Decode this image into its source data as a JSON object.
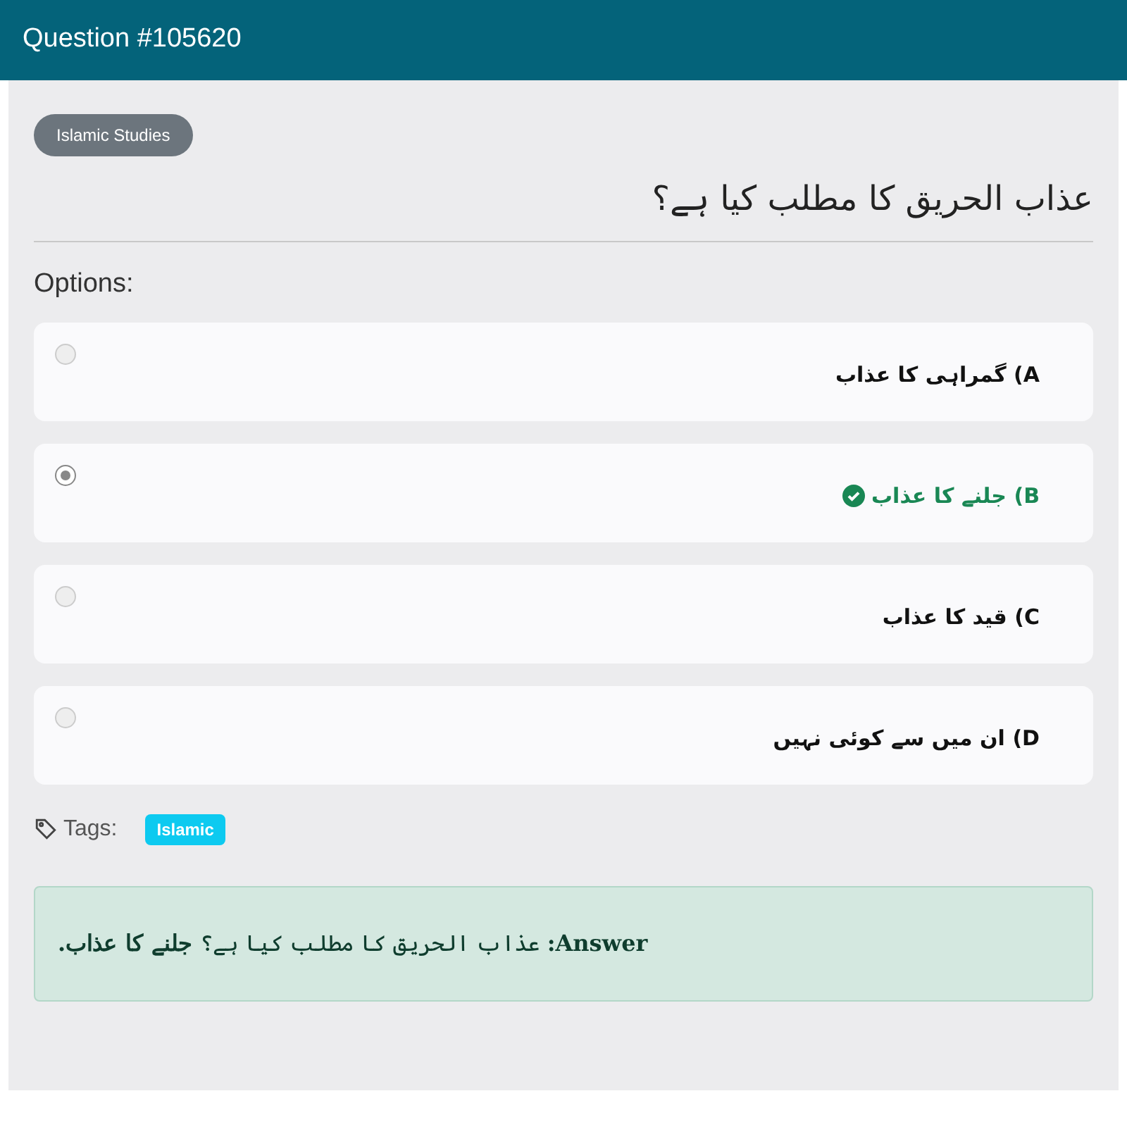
{
  "header": {
    "title": "Question #105620"
  },
  "category": "Islamic Studies",
  "question": "عذاب الحریق کا مطلب کیا ہے؟",
  "options_label": "Options:",
  "options": [
    {
      "letter": "A)",
      "text": "گمراہی کا عذاب",
      "selected": false,
      "correct": false
    },
    {
      "letter": "B)",
      "text": "جلنے کا عذاب",
      "selected": true,
      "correct": true
    },
    {
      "letter": "C)",
      "text": "قید کا عذاب",
      "selected": false,
      "correct": false
    },
    {
      "letter": "D)",
      "text": "ان میں سے کوئی نہیں",
      "selected": false,
      "correct": false
    }
  ],
  "tags_label": "Tags:",
  "tags": [
    "Islamic"
  ],
  "answer": "**Answer:** عذاب الحریق کا مطلب کیا ہے؟ **جلنے کا عذاب.**"
}
